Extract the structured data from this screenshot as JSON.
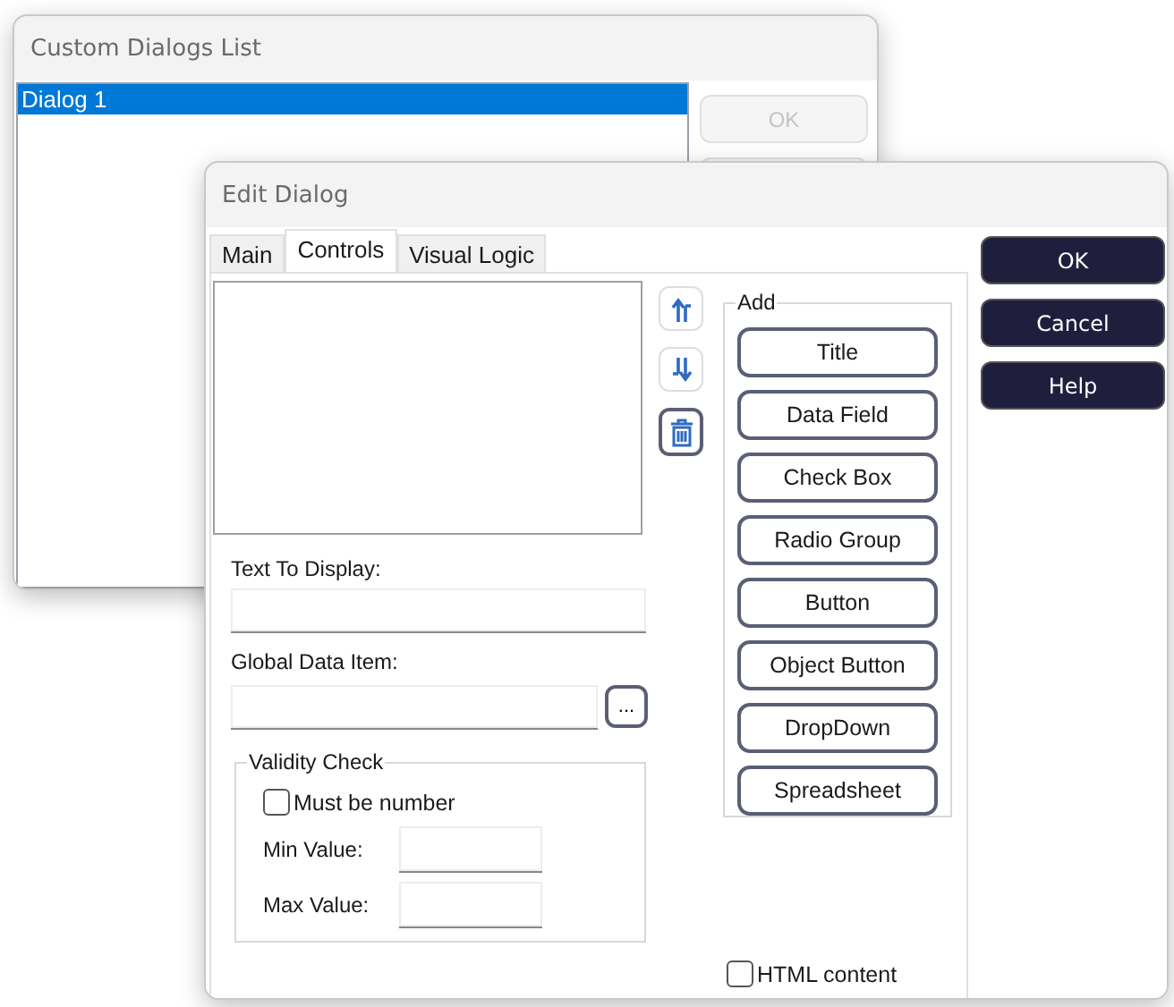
{
  "background_window": {
    "title": "Custom Dialogs List",
    "list_items": [
      {
        "label": "Dialog 1",
        "selected": true
      }
    ],
    "buttons": [
      {
        "label": "OK",
        "disabled": true
      }
    ]
  },
  "edit_dialog": {
    "title": "Edit Dialog",
    "tabs": [
      {
        "label": "Main",
        "selected": false
      },
      {
        "label": "Controls",
        "selected": true
      },
      {
        "label": "Visual Logic",
        "selected": false
      }
    ],
    "text_to_display": {
      "label": "Text To Display:"
    },
    "global_data_item": {
      "label": "Global Data Item:",
      "browse_button": "..."
    },
    "validity_check": {
      "label": "Validity Check",
      "must_be_number": {
        "label": "Must be number",
        "checked": false
      },
      "min_value": {
        "label": "Min Value:"
      },
      "max_value": {
        "label": "Max Value:"
      }
    },
    "add_group": {
      "label": "Add",
      "buttons": [
        "Title",
        "Data Field",
        "Check Box",
        "Radio Group",
        "Button",
        "Object Button",
        "DropDown",
        "Spreadsheet"
      ]
    },
    "html_content": {
      "label": "HTML content",
      "checked": false
    },
    "side_buttons": [
      "OK",
      "Cancel",
      "Help"
    ]
  }
}
